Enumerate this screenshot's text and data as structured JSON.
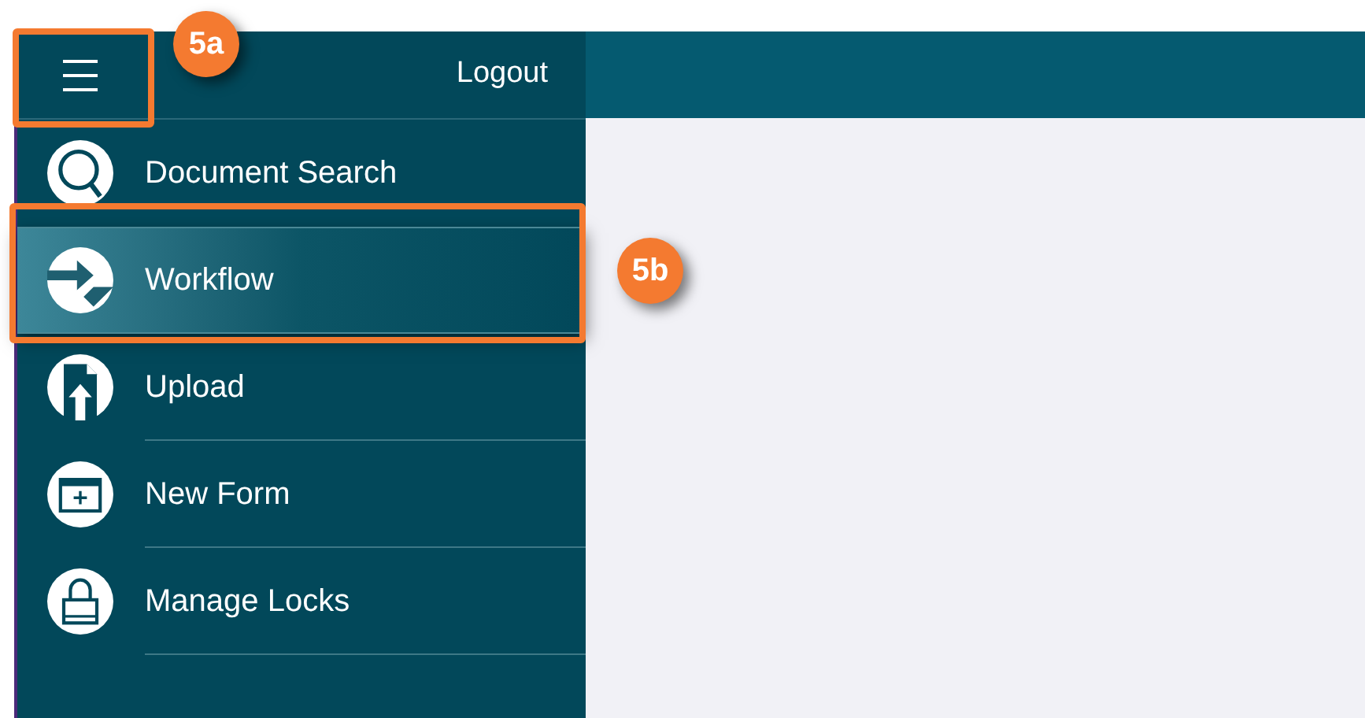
{
  "sidebar": {
    "logout": "Logout",
    "items": [
      {
        "label": "Document Search",
        "selected": false
      },
      {
        "label": "Workflow",
        "selected": true
      },
      {
        "label": "Upload",
        "selected": false
      },
      {
        "label": "New Form",
        "selected": false
      },
      {
        "label": "Manage Locks",
        "selected": false
      }
    ]
  },
  "callouts": [
    {
      "label": "5a"
    },
    {
      "label": "5b"
    }
  ]
}
